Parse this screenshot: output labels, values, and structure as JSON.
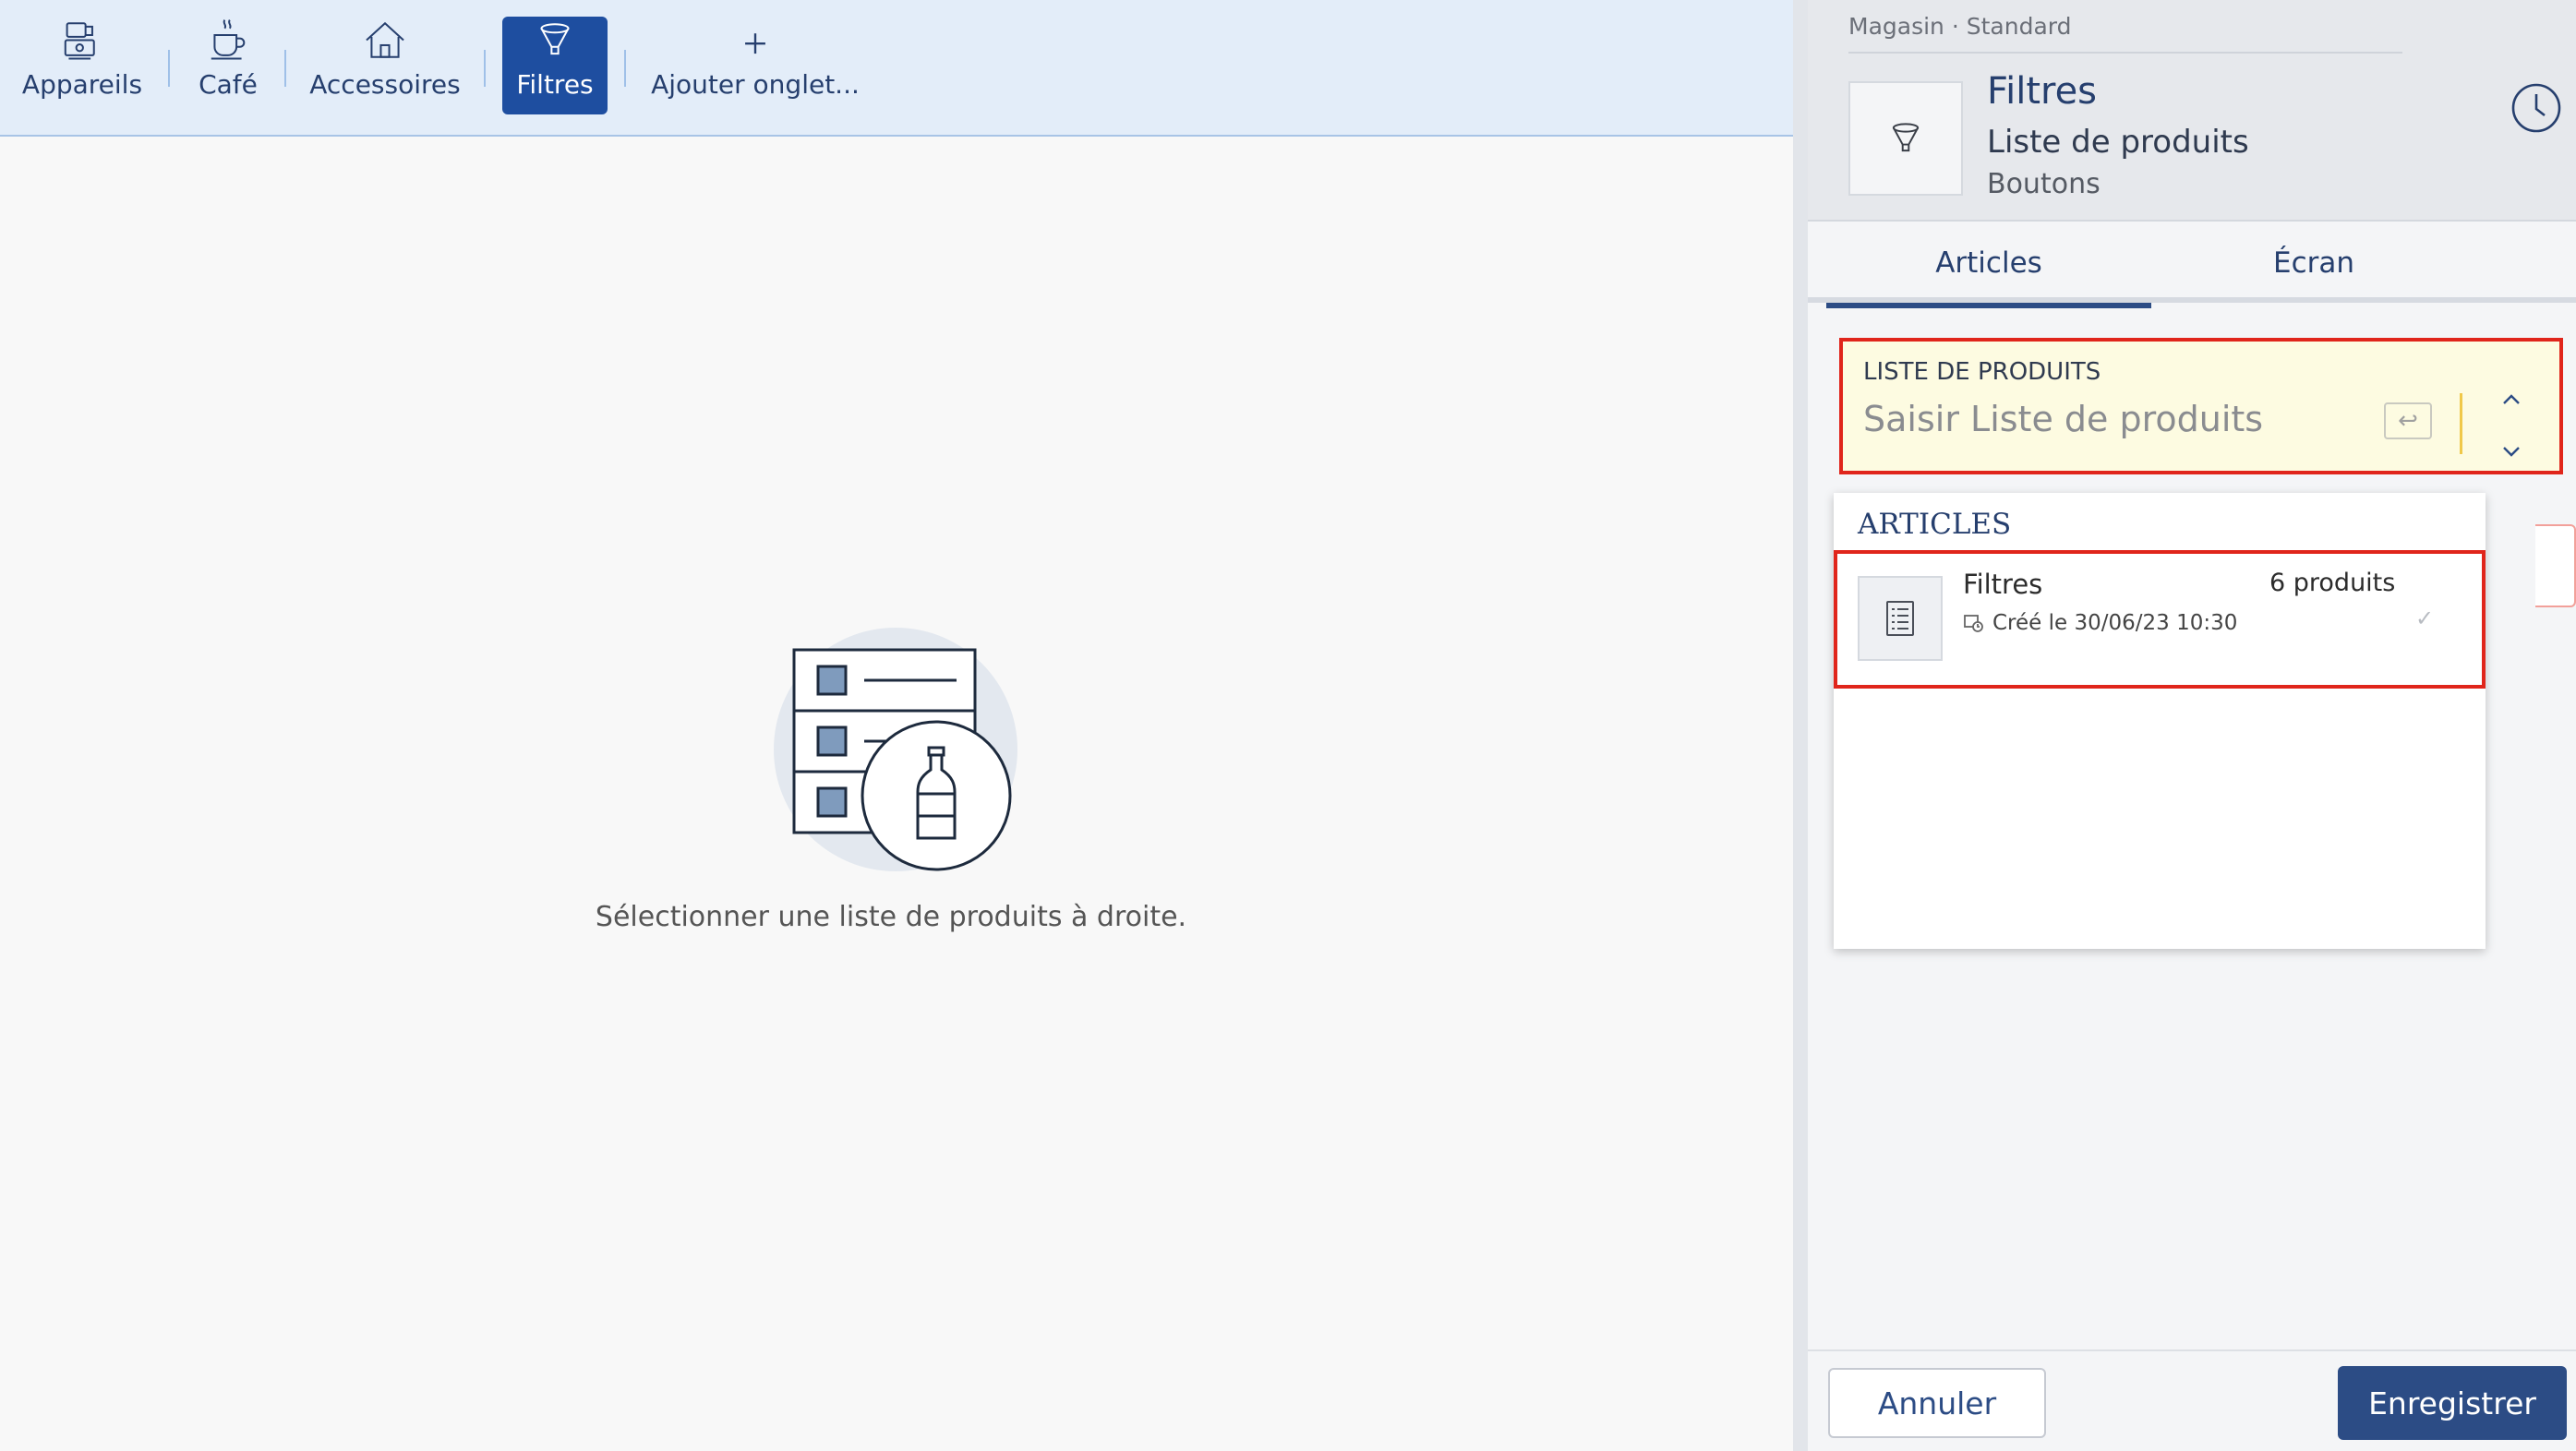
{
  "tabs": [
    {
      "label": "Appareils",
      "icon": "appliances-icon"
    },
    {
      "label": "Café",
      "icon": "coffee-cup-icon"
    },
    {
      "label": "Accessoires",
      "icon": "house-icon"
    },
    {
      "label": "Filtres",
      "icon": "filter-icon",
      "active": true
    },
    {
      "label": "Ajouter onglet...",
      "icon": "plus-icon"
    }
  ],
  "empty_state": {
    "message": "Sélectionner une liste de produits à droite.",
    "icon": "product-list-illustration"
  },
  "panel": {
    "breadcrumb": "Magasin · Standard",
    "title": "Filtres",
    "subtitle": "Liste de produits",
    "subtitle2": "Boutons",
    "icon": "filter-icon",
    "history_icon": "clock-icon",
    "tabs": [
      {
        "label": "Articles",
        "active": true
      },
      {
        "label": "Écran",
        "active": false
      }
    ],
    "field": {
      "label": "LISTE DE PRODUITS",
      "placeholder": "Saisir Liste de produits",
      "enter_glyph": "↩"
    },
    "dropdown": {
      "header": "ARTICLES",
      "items": [
        {
          "name": "Filtres",
          "count": "6 produits",
          "meta": "Créé le 30/06/23 10:30",
          "check": "✓"
        }
      ]
    },
    "footer": {
      "cancel": "Annuler",
      "save": "Enregistrer"
    }
  },
  "colors": {
    "accent": "#1e4ea0",
    "primary_button": "#2c4c85",
    "highlight_border": "#e0251b",
    "field_background": "#fdfbe1"
  }
}
